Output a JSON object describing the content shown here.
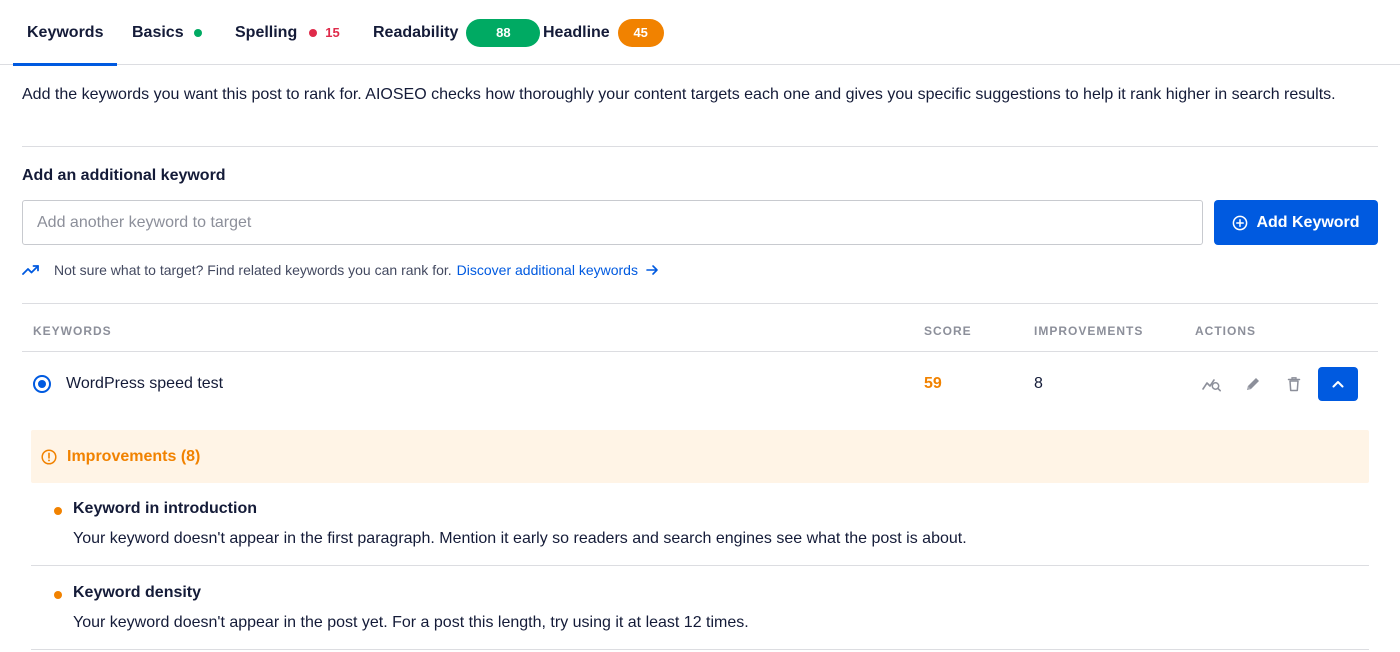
{
  "tabs": [
    {
      "label": "Keywords"
    },
    {
      "label": "Basics"
    },
    {
      "label": "Spelling",
      "count": "15"
    },
    {
      "label": "Readability",
      "score": "88"
    },
    {
      "label": "Headline",
      "score": "45"
    }
  ],
  "intro": "Add the keywords you want this post to rank for. AIOSEO checks how thoroughly your content targets each one and gives you specific suggestions to help it rank higher in search results.",
  "add_keyword": {
    "label": "Add an additional keyword",
    "placeholder": "Add another keyword to target",
    "button_label": "Add Keyword"
  },
  "hint": {
    "text": "Not sure what to target? Find related keywords you can rank for.",
    "link": "Discover additional keywords"
  },
  "table": {
    "headers": {
      "keywords": "KEYWORDS",
      "score": "SCORE",
      "improvements": "IMPROVEMENTS",
      "actions": "ACTIONS"
    },
    "rows": [
      {
        "keyword": "WordPress speed test",
        "score": "59",
        "improvements": "8"
      }
    ]
  },
  "improvements": {
    "title": "Improvements (8)",
    "items": [
      {
        "title": "Keyword in introduction",
        "desc": "Your keyword doesn't appear in the first paragraph. Mention it early so readers and search engines see what the post is about."
      },
      {
        "title": "Keyword density",
        "desc": "Your keyword doesn't appear in the post yet. For a post this length, try using it at least 12 times."
      }
    ]
  },
  "colors": {
    "accent": "#005ae0",
    "good": "#00aa63",
    "warning": "#f18200",
    "error": "#df2a4a",
    "warning_bg": "#fff4e6"
  },
  "icons": {
    "basics": "status-dot",
    "spelling": "status-dot",
    "add_button": "plus-circle-icon",
    "hint": "trending-up-icon",
    "hint_link": "arrow-right-icon",
    "actions": [
      "search-trend-icon",
      "pencil-icon",
      "trash-icon",
      "chevron-up-icon"
    ],
    "improvements": "alert-circle-icon"
  }
}
